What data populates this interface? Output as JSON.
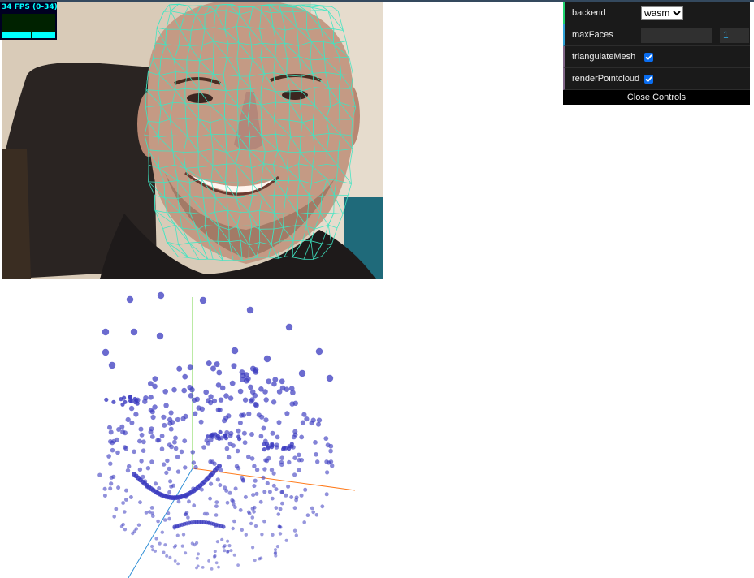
{
  "stats": {
    "fps_text": "34 FPS (0-34)"
  },
  "gui": {
    "controls": [
      {
        "label": "backend",
        "type": "select",
        "value": "wasm"
      },
      {
        "label": "maxFaces",
        "type": "number",
        "value": "1"
      },
      {
        "label": "triangulateMesh",
        "type": "boolean",
        "value": true
      },
      {
        "label": "renderPointcloud",
        "type": "boolean",
        "value": true
      }
    ],
    "close_label": "Close Controls"
  },
  "colors": {
    "mesh": "#3ee6c3",
    "points": "#3a3abf",
    "axis_x": "#ff7a1a",
    "axis_y": "#77d64a",
    "axis_z": "#2f8fd6"
  }
}
